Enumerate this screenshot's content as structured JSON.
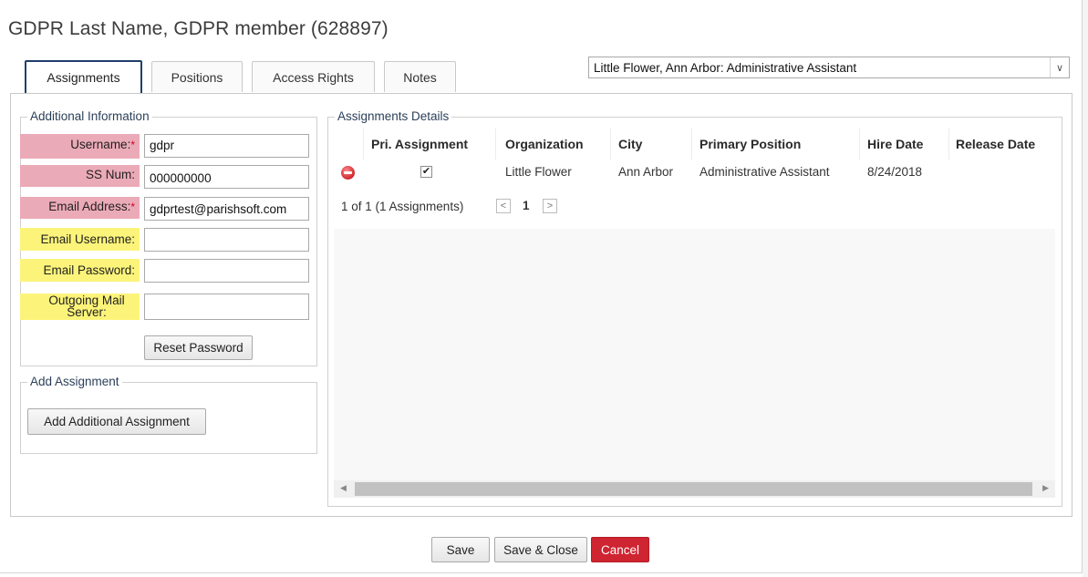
{
  "title": "GDPR Last Name, GDPR member (628897)",
  "tabs": [
    {
      "label": "Assignments",
      "active": true
    },
    {
      "label": "Positions"
    },
    {
      "label": "Access Rights"
    },
    {
      "label": "Notes"
    }
  ],
  "assignment_select": {
    "value": "Little Flower, Ann Arbor: Administrative Assistant"
  },
  "additional_info": {
    "legend": "Additional Information",
    "username": {
      "label": "Username:",
      "value": "gdpr",
      "required": "*"
    },
    "ss_num": {
      "label": "SS Num:",
      "value": "000000000"
    },
    "email_address": {
      "label": "Email Address:",
      "value": "gdprtest@parishsoft.com",
      "required": "*"
    },
    "email_username": {
      "label": "Email Username:",
      "value": ""
    },
    "email_password": {
      "label": "Email Password:",
      "value": ""
    },
    "outgoing_mail_server": {
      "label": "Outgoing Mail Server:",
      "value": ""
    },
    "reset_password_label": "Reset Password"
  },
  "add_assignment": {
    "legend": "Add Assignment",
    "button_label": "Add Additional Assignment"
  },
  "assignments_details": {
    "legend": "Assignments Details",
    "columns": [
      "Pri. Assignment",
      "Organization",
      "City",
      "Primary Position",
      "Hire Date",
      "Release Date"
    ],
    "rows": [
      {
        "primary": true,
        "organization": "Little Flower",
        "city": "Ann Arbor",
        "position": "Administrative Assistant",
        "hire_date": "8/24/2018",
        "release_date": ""
      }
    ],
    "pager": {
      "summary": "1 of 1 (1 Assignments)",
      "current_page": "1"
    }
  },
  "footer": {
    "save": "Save",
    "save_close": "Save & Close",
    "cancel": "Cancel"
  },
  "colors": {
    "required_bg": "#ebaab7",
    "email_bg": "#fcf47a",
    "cancel": "#cf2431",
    "active_tab_border": "#1f3f6b"
  }
}
